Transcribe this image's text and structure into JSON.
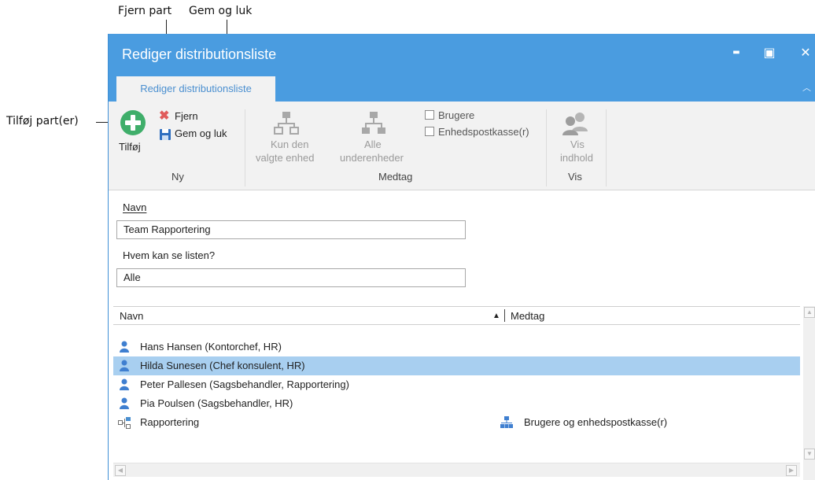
{
  "annotations": {
    "remove_party": "Fjern part",
    "save_close": "Gem og luk",
    "add_parties": "Tilføj part(er)"
  },
  "window": {
    "title": "Rediger distributionsliste",
    "minimize": "▬",
    "maximize": "▣",
    "close": "✕"
  },
  "tab": {
    "label": "Rediger distributionsliste",
    "collapse": "︿"
  },
  "ribbon": {
    "add": "Tilføj",
    "remove": "Fjern",
    "save_close": "Gem og luk",
    "group_new": "Ny",
    "only_selected_line1": "Kun den",
    "only_selected_line2": "valgte enhed",
    "all_sub_line1": "Alle",
    "all_sub_line2": "underenheder",
    "users_checkbox": "Brugere",
    "mailbox_checkbox": "Enhedspostkasse(r)",
    "group_include": "Medtag",
    "show_content_line1": "Vis",
    "show_content_line2": "indhold",
    "group_show": "Vis"
  },
  "form": {
    "name_label": "Navn",
    "name_value": "Team Rapportering",
    "who_label": "Hvem kan se listen?",
    "who_value": "Alle"
  },
  "list": {
    "col_name": "Navn",
    "sort_indicator": "▲",
    "col_include": "Medtag",
    "rows": [
      {
        "name": "Hans Hansen (Kontorchef, HR)",
        "type": "user-icon"
      },
      {
        "name": "Hilda Sunesen  (Chef konsulent, HR)",
        "type": "user-icon",
        "selected": true
      },
      {
        "name": "Peter Pallesen (Sagsbehandler, Rapportering)",
        "type": "user-icon"
      },
      {
        "name": "Pia Poulsen (Sagsbehandler, HR)",
        "type": "user-icon"
      },
      {
        "name": "Rapportering",
        "type": "unit-icon",
        "include": "Brugere og enhedspostkasse(r)"
      }
    ]
  },
  "colors": {
    "titlebar": "#4a9ce0",
    "selection": "#a8cff0",
    "add_green": "#3fae6a",
    "remove_red": "#e05a5a",
    "save_blue": "#2f6fc0"
  }
}
